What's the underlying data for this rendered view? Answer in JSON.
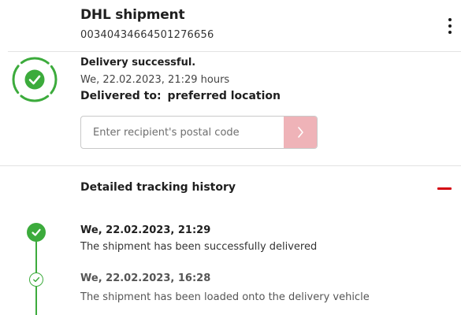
{
  "header": {
    "title": "DHL shipment",
    "tracking_number": "00340434664501276656",
    "menu_icon": "more-vertical-icon"
  },
  "status": {
    "icon": "check-circle-icon",
    "title": "Delivery successful.",
    "datetime": "We, 22.02.2023, 21:29 hours",
    "delivered_to_label": "Delivered to:",
    "delivered_to_value": "preferred location",
    "color": "#3cab3c"
  },
  "postal_code": {
    "placeholder": "Enter recipient's postal code",
    "value": "",
    "submit_icon": "chevron-right-icon",
    "submit_color": "#efb3b8"
  },
  "history": {
    "title": "Detailed tracking history",
    "toggle_icon": "minus-icon",
    "accent": "#d40511",
    "events": [
      {
        "datetime": "We, 22.02.2023, 21:29",
        "description": "The shipment has been successfully delivered",
        "icon": "check-circle-filled-icon"
      },
      {
        "datetime": "We, 22.02.2023, 16:28",
        "description": "The shipment has been loaded onto the delivery vehicle",
        "icon": "check-circle-outline-icon"
      }
    ]
  }
}
